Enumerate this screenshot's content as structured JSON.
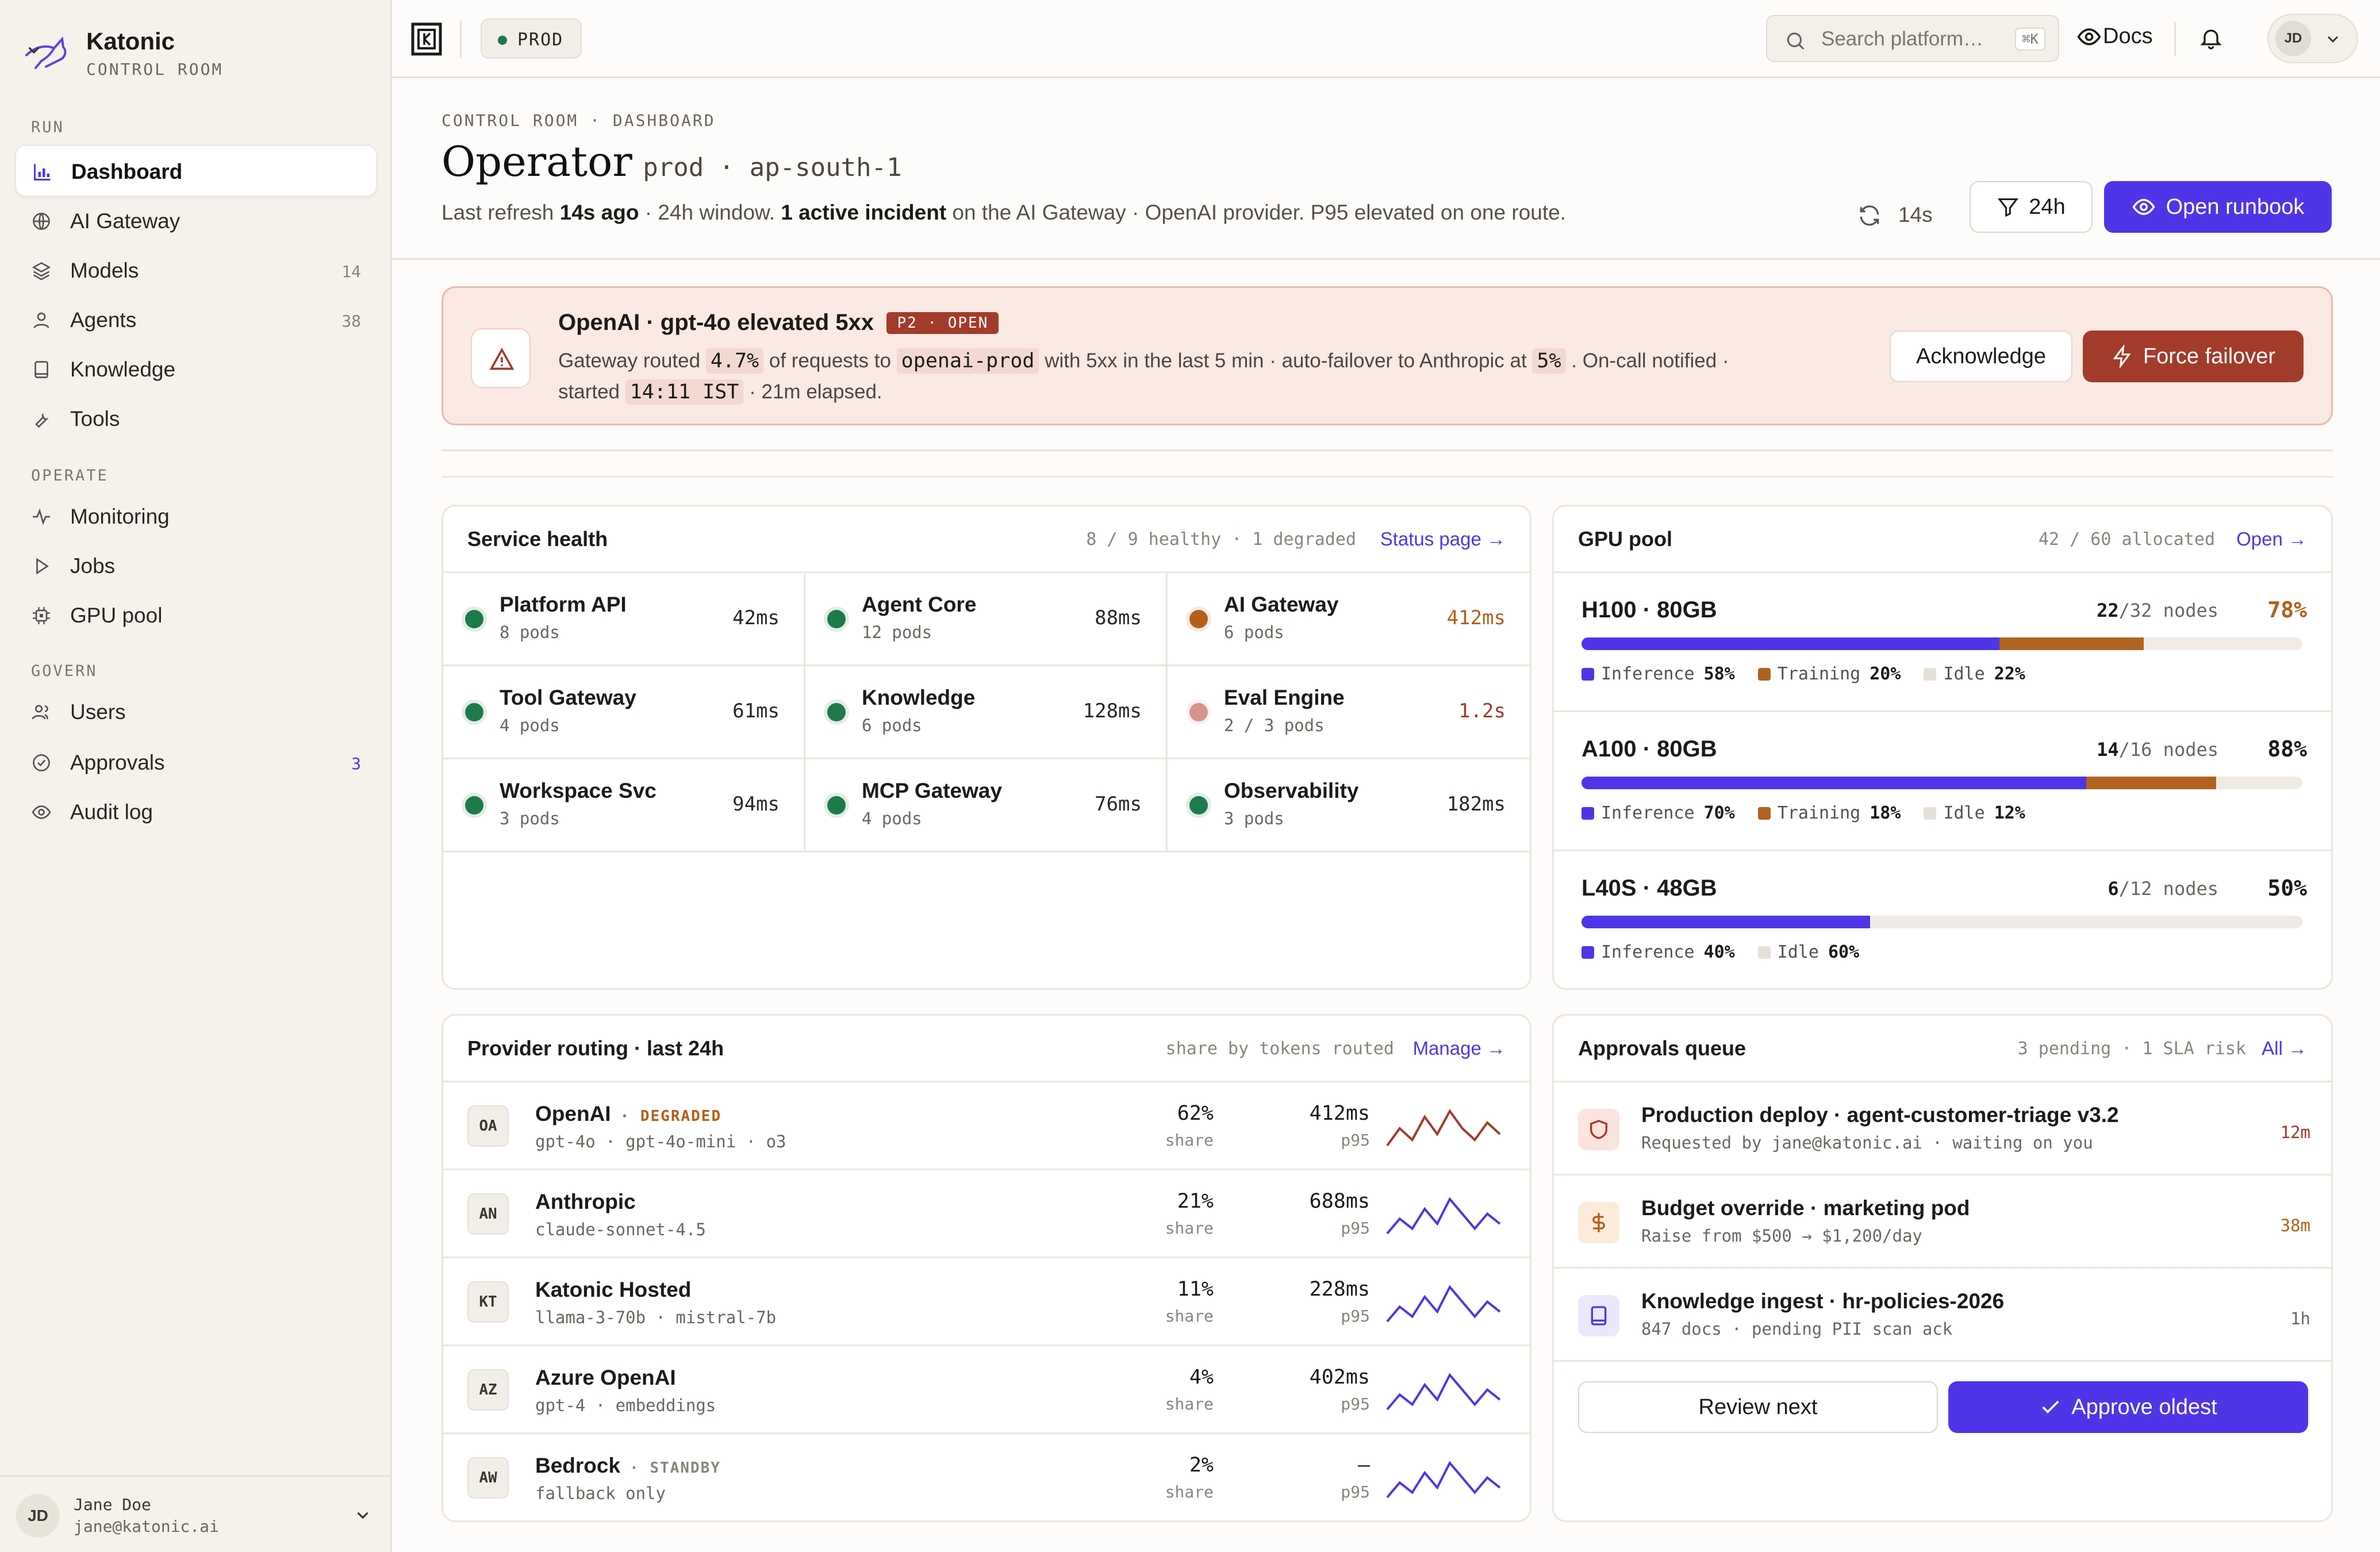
{
  "brand": {
    "name": "Katonic",
    "sub": "CONTROL ROOM"
  },
  "nav": {
    "run_label": "RUN",
    "operate_label": "OPERATE",
    "govern_label": "GOVERN",
    "items": [
      {
        "label": "Dashboard",
        "count": ""
      },
      {
        "label": "AI Gateway",
        "count": ""
      },
      {
        "label": "Models",
        "count": "14"
      },
      {
        "label": "Agents",
        "count": "38"
      },
      {
        "label": "Knowledge",
        "count": ""
      },
      {
        "label": "Tools",
        "count": ""
      },
      {
        "label": "Monitoring",
        "count": ""
      },
      {
        "label": "Jobs",
        "count": ""
      },
      {
        "label": "GPU pool",
        "count": ""
      },
      {
        "label": "Users",
        "count": ""
      },
      {
        "label": "Approvals",
        "count": "3"
      },
      {
        "label": "Audit log",
        "count": ""
      }
    ]
  },
  "user": {
    "initials": "JD",
    "name": "Jane Doe",
    "email": "jane@katonic.ai"
  },
  "topbar": {
    "env": "PROD",
    "search_placeholder": "Search platform…",
    "search_kbd": "⌘K",
    "docs": "Docs",
    "initials": "JD"
  },
  "header": {
    "breadcrumb": "CONTROL ROOM · DASHBOARD",
    "title": "Operator",
    "title_env": "prod · ap-south-1",
    "sub_a": "Last refresh ",
    "sub_b": "14s ago",
    "sub_c": " · 24h window. ",
    "sub_d": "1 active incident",
    "sub_e": " on the AI Gateway · OpenAI provider. P95 elevated on one route.",
    "refresh": "14s",
    "window": "24h",
    "runbook": "Open runbook"
  },
  "incident": {
    "title": "OpenAI · gpt-4o elevated 5xx",
    "badge": "P2 · OPEN",
    "t1": "Gateway routed",
    "v1": "4.7%",
    "t2": "of requests to",
    "v2": "openai-prod",
    "t3": "with 5xx in the last 5 min · auto-failover to Anthropic at",
    "v3": "5%",
    "t4": ". On-call notified ·",
    "t5": "started",
    "v4": "14:11 IST",
    "t6": "· 21m elapsed.",
    "ack": "Acknowledge",
    "failover": "Force failover"
  },
  "service": {
    "title": "Service health",
    "meta": "8 / 9 healthy · 1 degraded",
    "link": "Status page →",
    "items": [
      {
        "name": "Platform API",
        "pods": "8 pods",
        "lat": "42ms",
        "status": "ok"
      },
      {
        "name": "Agent Core",
        "pods": "12 pods",
        "lat": "88ms",
        "status": "ok"
      },
      {
        "name": "AI Gateway",
        "pods": "6 pods",
        "lat": "412ms",
        "status": "warn"
      },
      {
        "name": "Tool Gateway",
        "pods": "4 pods",
        "lat": "61ms",
        "status": "ok"
      },
      {
        "name": "Knowledge",
        "pods": "6 pods",
        "lat": "128ms",
        "status": "ok"
      },
      {
        "name": "Eval Engine",
        "pods": "2 / 3 pods",
        "lat": "1.2s",
        "status": "bad"
      },
      {
        "name": "Workspace Svc",
        "pods": "3 pods",
        "lat": "94ms",
        "status": "ok"
      },
      {
        "name": "MCP Gateway",
        "pods": "4 pods",
        "lat": "76ms",
        "status": "ok"
      },
      {
        "name": "Observability",
        "pods": "3 pods",
        "lat": "182ms",
        "status": "ok"
      }
    ]
  },
  "gpu": {
    "title": "GPU pool",
    "meta": "42 / 60 allocated",
    "link": "Open →",
    "pools": [
      {
        "name": "H100 · 80GB",
        "used": "22",
        "total": "/32 nodes",
        "pct": "78%",
        "inference": 58,
        "training": 20,
        "idle": 22,
        "l_inf": "Inference",
        "v_inf": "58%",
        "l_tr": "Training",
        "v_tr": "20%",
        "l_idle": "Idle",
        "v_idle": "22%"
      },
      {
        "name": "A100 · 80GB",
        "used": "14",
        "total": "/16 nodes",
        "pct": "88%",
        "inference": 70,
        "training": 18,
        "idle": 12,
        "l_inf": "Inference",
        "v_inf": "70%",
        "l_tr": "Training",
        "v_tr": "18%",
        "l_idle": "Idle",
        "v_idle": "12%"
      },
      {
        "name": "L40S · 48GB",
        "used": "6",
        "total": "/12 nodes",
        "pct": "50%",
        "inference": 40,
        "training": 0,
        "idle": 60,
        "l_inf": "Inference",
        "v_inf": "40%",
        "l_tr": "",
        "v_tr": "",
        "l_idle": "Idle",
        "v_idle": "60%"
      }
    ]
  },
  "routing": {
    "title": "Provider routing · last 24h",
    "meta": "share by tokens routed",
    "link": "Manage →",
    "share_label": "share",
    "p95_label": "p95",
    "providers": [
      {
        "abbr": "OA",
        "name": "OpenAI",
        "tag": "· DEGRADED",
        "models": "gpt-4o · gpt-4o-mini · o3",
        "share": "62%",
        "p95": "412ms",
        "spark": [
          3,
          6,
          4,
          8,
          5,
          9,
          6,
          4,
          7,
          5
        ]
      },
      {
        "abbr": "AN",
        "name": "Anthropic",
        "tag": "",
        "models": "claude-sonnet-4.5",
        "share": "21%",
        "p95": "688ms",
        "spark": [
          2,
          5,
          3,
          7,
          4,
          9,
          6,
          3,
          6,
          4
        ]
      },
      {
        "abbr": "KT",
        "name": "Katonic Hosted",
        "tag": "",
        "models": "llama-3-70b · mistral-7b",
        "share": "11%",
        "p95": "228ms",
        "spark": [
          2,
          5,
          3,
          7,
          4,
          9,
          6,
          3,
          6,
          4
        ]
      },
      {
        "abbr": "AZ",
        "name": "Azure OpenAI",
        "tag": "",
        "models": "gpt-4 · embeddings",
        "share": "4%",
        "p95": "402ms",
        "spark": [
          2,
          5,
          3,
          7,
          4,
          9,
          6,
          3,
          6,
          4
        ]
      },
      {
        "abbr": "AW",
        "name": "Bedrock",
        "tag": "· STANDBY",
        "models": "fallback only",
        "share": "2%",
        "p95": "—",
        "spark": [
          2,
          5,
          3,
          7,
          4,
          9,
          6,
          3,
          6,
          4
        ]
      }
    ]
  },
  "approvals": {
    "title": "Approvals queue",
    "meta": "3 pending · 1 SLA risk",
    "link": "All →",
    "items": [
      {
        "title": "Production deploy · agent-customer-triage v3.2",
        "sub": "Requested by jane@katonic.ai · waiting on you",
        "age": "12m",
        "kind": "shield"
      },
      {
        "title": "Budget override · marketing pod",
        "sub": "Raise from $500 → $1,200/day",
        "age": "38m",
        "kind": "dollar"
      },
      {
        "title": "Knowledge ingest · hr-policies-2026",
        "sub": "847 docs · pending PII scan ack",
        "age": "1h",
        "kind": "book"
      }
    ],
    "review": "Review next",
    "approve": "Approve oldest"
  },
  "colors": {
    "accent": "#4f35e8",
    "ok": "#1e7a4a",
    "warn": "#b45f1a",
    "bad": "#d9938c",
    "danger": "#a33b2a",
    "training": "#b0631f",
    "idle": "#efebe4"
  }
}
